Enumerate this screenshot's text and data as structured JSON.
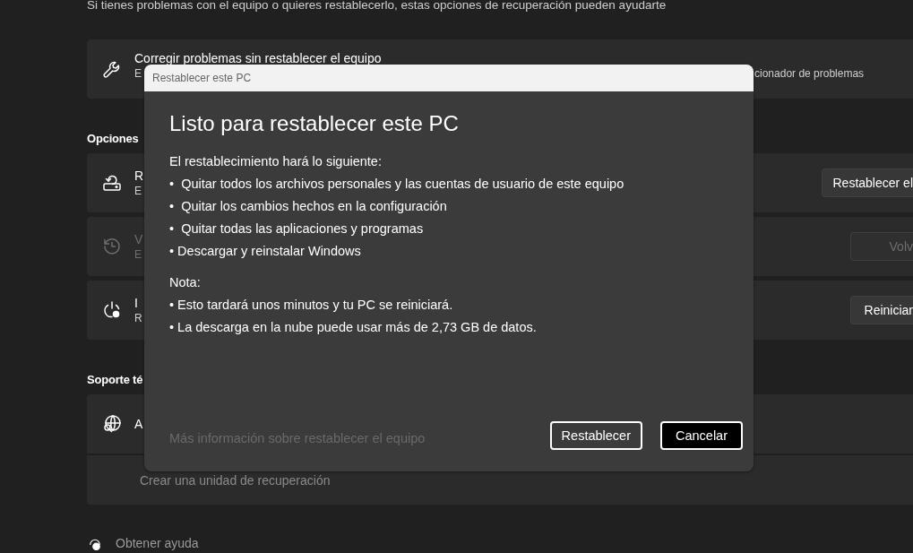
{
  "intro": "Si tienes problemas con el equipo o quieres restablecerlo, estas opciones de recuperación pueden ayudarte",
  "troubleshoot_card": {
    "title": "Corregir problemas sin restablecer el equipo",
    "subtitle_start": "E",
    "subtitle_end": "cionador de problemas"
  },
  "options_heading": "Opciones",
  "option_cards": [
    {
      "title": "R",
      "subtitle": "E",
      "button": "Restablecer el",
      "disabled": false
    },
    {
      "title": "V",
      "subtitle": "E",
      "button": "Volv",
      "disabled": true
    },
    {
      "title": "I",
      "subtitle": "R",
      "button": "Reiniciar",
      "disabled": false
    }
  ],
  "support_heading": "Soporte té",
  "support_card": {
    "title": "A",
    "link": "Crear una unidad de recuperación"
  },
  "help_link": "Obtener ayuda",
  "dialog": {
    "window_title": "Restablecer este PC",
    "heading": "Listo para restablecer este PC",
    "intro": "El restablecimiento hará lo siguiente:",
    "actions": [
      "•  Quitar todos los archivos personales y las cuentas de usuario de este equipo",
      "•  Quitar los cambios hechos en la configuración",
      "•  Quitar todas las aplicaciones y programas",
      "• Descargar y reinstalar Windows"
    ],
    "note_label": "Nota:",
    "notes": [
      "• Esto tardará unos minutos y tu PC se reiniciará.",
      "• La descarga en la nube puede usar más de 2,73 GB de datos."
    ],
    "link": "Más información sobre restablecer el equipo",
    "buttons": [
      {
        "label": "Restablecer",
        "selected": false
      },
      {
        "label": "Cancelar",
        "selected": true
      }
    ]
  }
}
